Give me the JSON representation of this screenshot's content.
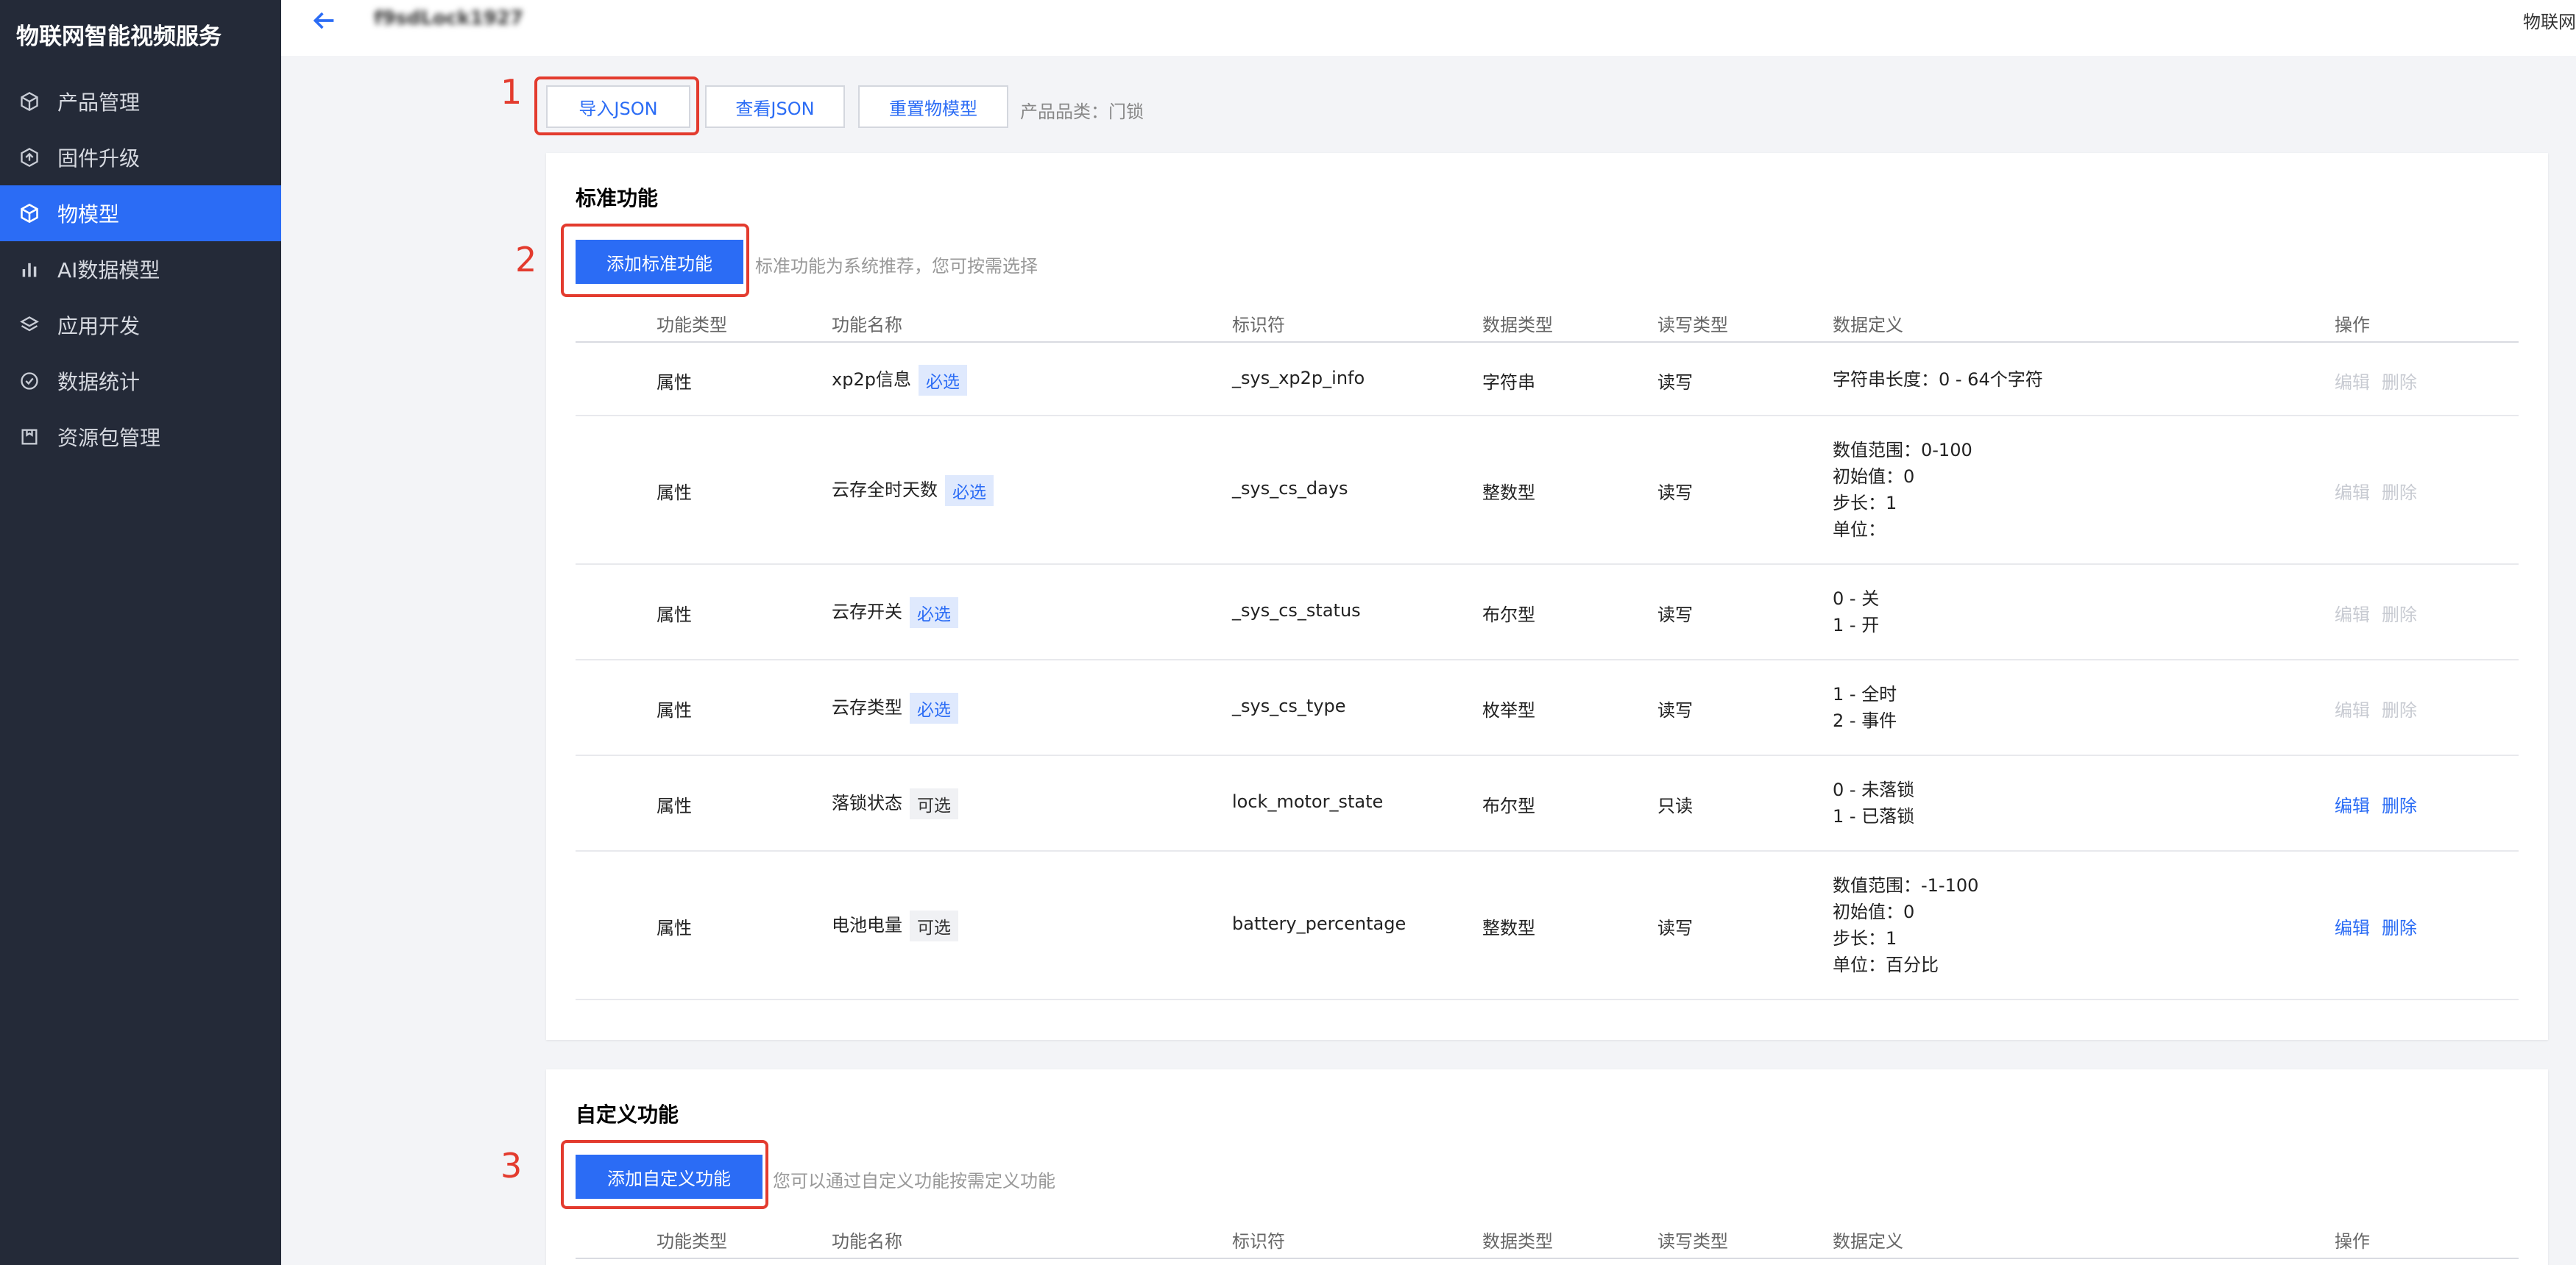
{
  "app": {
    "brand": "物联网智能视频服务",
    "top_right": "物联网"
  },
  "header": {
    "product_name": "f9sdLock1927"
  },
  "sidebar": {
    "items": [
      {
        "label": "产品管理",
        "icon": "cube-outline-icon",
        "active": false
      },
      {
        "label": "固件升级",
        "icon": "upgrade-hexagon-icon",
        "active": false
      },
      {
        "label": "物模型",
        "icon": "cube-icon",
        "active": true
      },
      {
        "label": "AI数据模型",
        "icon": "bar-chart-icon",
        "active": false
      },
      {
        "label": "应用开发",
        "icon": "layers-icon",
        "active": false
      },
      {
        "label": "数据统计",
        "icon": "check-circle-icon",
        "active": false
      },
      {
        "label": "资源包管理",
        "icon": "package-box-icon",
        "active": false
      }
    ]
  },
  "toolbar": {
    "import_json": "导入JSON",
    "view_json": "查看JSON",
    "reset_model": "重置物模型",
    "category_text": "产品品类：门锁"
  },
  "annotations": {
    "n1": "1",
    "n2": "2",
    "n3": "3"
  },
  "standard": {
    "title": "标准功能",
    "add_button": "添加标准功能",
    "hint": "标准功能为系统推荐，您可按需选择",
    "columns": [
      "功能类型",
      "功能名称",
      "标识符",
      "数据类型",
      "读写类型",
      "数据定义",
      "操作"
    ],
    "rows": [
      {
        "type": "属性",
        "name": "xp2p信息",
        "tag": "必选",
        "tag_kind": "req",
        "identifier": "_sys_xp2p_info",
        "data_type": "字符串",
        "rw": "读写",
        "def": [
          "字符串长度：0 - 64个字符"
        ],
        "edit": "编辑",
        "delete": "删除",
        "ops_enabled": false
      },
      {
        "type": "属性",
        "name": "云存全时天数",
        "tag": "必选",
        "tag_kind": "req",
        "identifier": "_sys_cs_days",
        "data_type": "整数型",
        "rw": "读写",
        "def": [
          "数值范围：0-100",
          "初始值：0",
          "步长：1",
          "单位："
        ],
        "edit": "编辑",
        "delete": "删除",
        "ops_enabled": false
      },
      {
        "type": "属性",
        "name": "云存开关",
        "tag": "必选",
        "tag_kind": "req",
        "identifier": "_sys_cs_status",
        "data_type": "布尔型",
        "rw": "读写",
        "def": [
          "0 - 关",
          "1 - 开"
        ],
        "edit": "编辑",
        "delete": "删除",
        "ops_enabled": false
      },
      {
        "type": "属性",
        "name": "云存类型",
        "tag": "必选",
        "tag_kind": "req",
        "identifier": "_sys_cs_type",
        "data_type": "枚举型",
        "rw": "读写",
        "def": [
          "1 - 全时",
          "2 - 事件"
        ],
        "edit": "编辑",
        "delete": "删除",
        "ops_enabled": false
      },
      {
        "type": "属性",
        "name": "落锁状态",
        "tag": "可选",
        "tag_kind": "opt",
        "identifier": "lock_motor_state",
        "data_type": "布尔型",
        "rw": "只读",
        "def": [
          "0 - 未落锁",
          "1 - 已落锁"
        ],
        "edit": "编辑",
        "delete": "删除",
        "ops_enabled": true
      },
      {
        "type": "属性",
        "name": "电池电量",
        "tag": "可选",
        "tag_kind": "opt",
        "identifier": "battery_percentage",
        "data_type": "整数型",
        "rw": "读写",
        "def": [
          "数值范围：-1-100",
          "初始值：0",
          "步长：1",
          "单位：百分比"
        ],
        "edit": "编辑",
        "delete": "删除",
        "ops_enabled": true
      }
    ]
  },
  "custom": {
    "title": "自定义功能",
    "add_button": "添加自定义功能",
    "hint": "您可以通过自定义功能按需定义功能",
    "columns": [
      "功能类型",
      "功能名称",
      "标识符",
      "数据类型",
      "读写类型",
      "数据定义",
      "操作"
    ]
  },
  "colors": {
    "accent": "#2b6cf5",
    "sidebar_bg": "#242a38",
    "annotation_red": "#e33b2e"
  }
}
